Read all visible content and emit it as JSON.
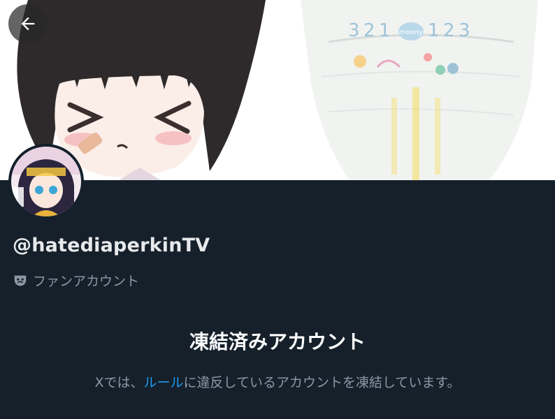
{
  "profile": {
    "handle": "@hatediaperkinTV",
    "account_label": "ファンアカウント",
    "account_label_icon": "theater-mask-icon"
  },
  "suspension": {
    "title": "凍結済みアカウント",
    "text_before": "Xでは、",
    "rules_link": "ルール",
    "text_after": "に違反しているアカウントを凍結しています。"
  },
  "banner_print": {
    "mark1": "3",
    "mark2": "2",
    "mark3": "1",
    "brand": "moony",
    "mark4": "1",
    "mark5": "2",
    "mark6": "3"
  },
  "colors": {
    "background": "#15202b",
    "primary_text": "#e7e9ea",
    "secondary_text": "#8b98a5",
    "link": "#1d9bf0"
  }
}
